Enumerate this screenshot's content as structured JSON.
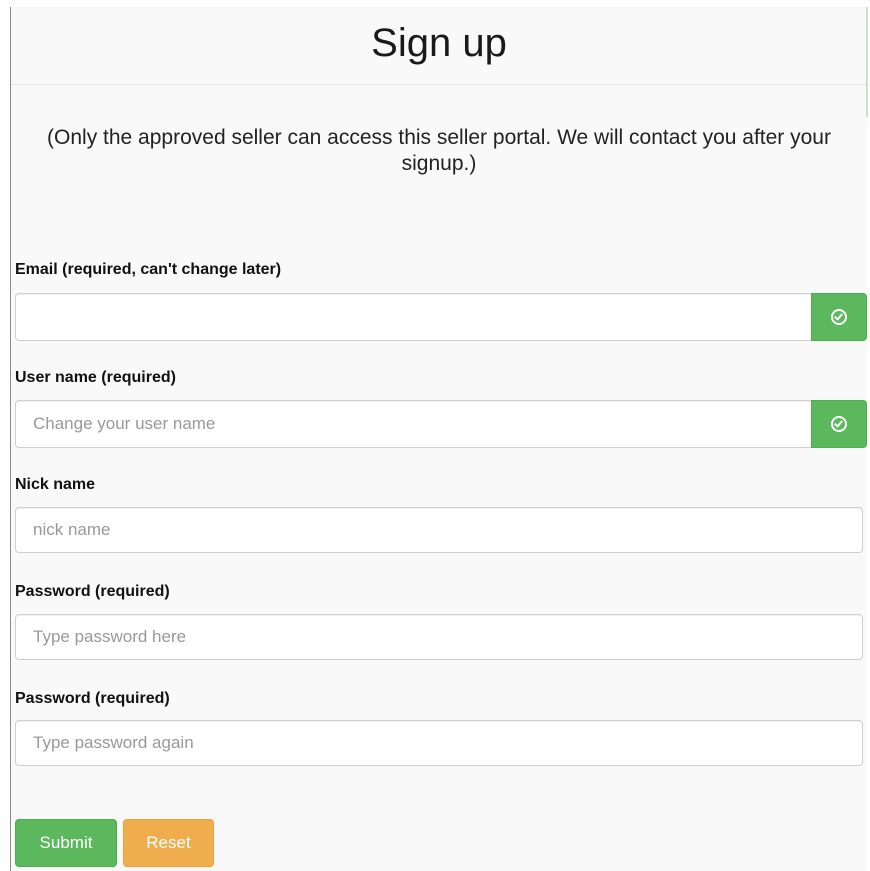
{
  "page": {
    "title": "Sign up",
    "notice": "(Only the approved seller can access this seller portal. We will contact you after your signup.)"
  },
  "form": {
    "email": {
      "label": "Email (required, can't change later)",
      "value": "",
      "placeholder": "",
      "addon_icon": "check-circle-icon"
    },
    "username": {
      "label": "User name (required)",
      "value": "",
      "placeholder": "Change your user name",
      "addon_icon": "check-circle-icon"
    },
    "nickname": {
      "label": "Nick name",
      "value": "",
      "placeholder": "nick name"
    },
    "password": {
      "label": "Password (required)",
      "value": "",
      "placeholder": "Type password here"
    },
    "password_confirm": {
      "label": "Password (required)",
      "value": "",
      "placeholder": "Type password again"
    }
  },
  "buttons": {
    "submit_label": "Submit",
    "reset_label": "Reset"
  },
  "colors": {
    "success": "#5cb85c",
    "warning": "#f0ad4e",
    "background": "#f9f9f9"
  }
}
